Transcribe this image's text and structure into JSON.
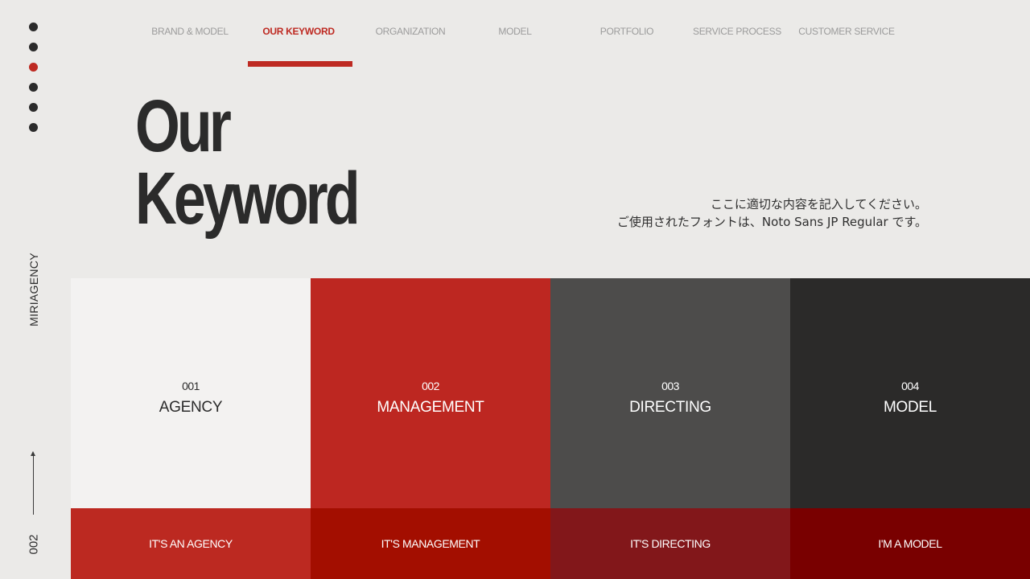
{
  "nav": {
    "items": [
      {
        "label": "BRAND & MODEL"
      },
      {
        "label": "OUR KEYWORD"
      },
      {
        "label": "ORGANIZATION"
      },
      {
        "label": "MODEL"
      },
      {
        "label": "PORTFOLIO"
      },
      {
        "label": "SERVICE PROCESS"
      },
      {
        "label": "CUSTOMER SERVICE"
      }
    ],
    "active": "OUR KEYWORD"
  },
  "sidebar": {
    "brand": "MIRIAGENCY",
    "page_number": "002",
    "dots_count": 6,
    "active_dot": 3
  },
  "hero": {
    "title_line1": "Our",
    "title_line2": "Keyword",
    "desc_line1": "ここに適切な内容を記入してください。",
    "desc_line2": "ご使用されたフォントは、Noto Sans JP Regular です。"
  },
  "cards": [
    {
      "number": "001",
      "title": "AGENCY",
      "caption": "IT'S AN AGENCY"
    },
    {
      "number": "002",
      "title": "MANAGEMENT",
      "caption": "IT'S MANAGEMENT"
    },
    {
      "number": "003",
      "title": "DIRECTING",
      "caption": "IT'S DIRECTING"
    },
    {
      "number": "004",
      "title": "MODEL",
      "caption": "I'M A MODEL"
    }
  ],
  "colors": {
    "accent": "#be2a22",
    "background": "#ebeae8",
    "text": "#2b2b2b"
  }
}
